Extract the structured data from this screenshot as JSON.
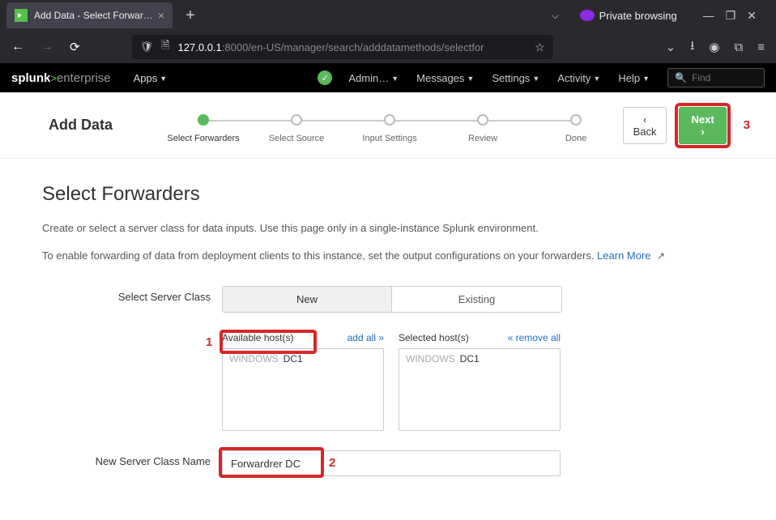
{
  "browser": {
    "tab_title": "Add Data - Select Forwar…",
    "private_label": "Private browsing",
    "url_host": "127.0.0.1",
    "url_path": ":8000/en-US/manager/search/adddatamethods/selectfor"
  },
  "splunkbar": {
    "logo_bold": "splunk",
    "logo_rest": "enterprise",
    "apps": "Apps",
    "admin": "Admin…",
    "messages": "Messages",
    "settings": "Settings",
    "activity": "Activity",
    "help": "Help",
    "find_placeholder": "Find"
  },
  "wizard": {
    "title": "Add Data",
    "steps": [
      "Select Forwarders",
      "Select Source",
      "Input Settings",
      "Review",
      "Done"
    ],
    "back": "Back",
    "next": "Next"
  },
  "page": {
    "heading": "Select Forwarders",
    "sub1": "Create or select a server class for data inputs. Use this page only in a single-instance Splunk environment.",
    "sub2": "To enable forwarding of data from deployment clients to this instance, set the output configurations on your forwarders. ",
    "learn_more": "Learn More"
  },
  "form": {
    "server_class_label": "Select Server Class",
    "new_label": "New",
    "existing_label": "Existing",
    "available_label": "Available host(s)",
    "add_all": "add all »",
    "selected_label": "Selected host(s)",
    "remove_all": "« remove all",
    "hosts_available_prefix": "WINDOWS",
    "hosts_available_name": "DC1",
    "hosts_selected_prefix": "WINDOWS",
    "hosts_selected_name": "DC1",
    "new_class_label": "New Server Class Name",
    "new_class_value": "Forwardrer DC"
  },
  "annotations": {
    "a1": "1",
    "a2": "2",
    "a3": "3"
  }
}
